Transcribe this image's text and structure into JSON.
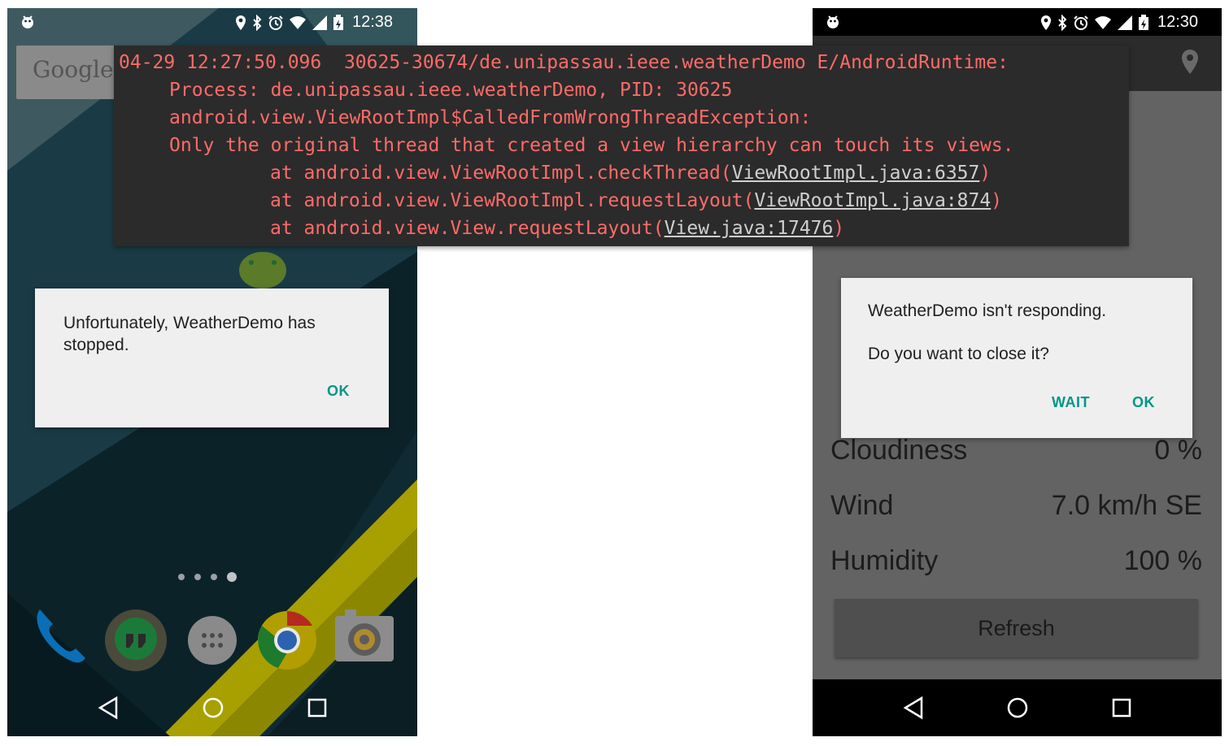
{
  "left_phone": {
    "statusbar": {
      "time": "12:38"
    },
    "search": {
      "logo_text": "Google"
    },
    "home_dots": 4,
    "dock_apps": [
      "phone",
      "hangouts",
      "app-drawer",
      "chrome",
      "camera"
    ],
    "crash_dialog": {
      "message": "Unfortunately, WeatherDemo has stopped.",
      "ok_label": "OK"
    }
  },
  "right_phone": {
    "statusbar": {
      "time": "12:30"
    },
    "anr_dialog": {
      "title": "WeatherDemo isn't responding.",
      "message": "Do you want to close it?",
      "wait_label": "WAIT",
      "ok_label": "OK"
    },
    "weather": [
      {
        "label": "Cloudiness",
        "value": "0 %"
      },
      {
        "label": "Wind",
        "value": "7.0 km/h SE"
      },
      {
        "label": "Humidity",
        "value": "100 %"
      }
    ],
    "refresh_label": "Refresh"
  },
  "logcat": {
    "header": "04-29 12:27:50.096  30625-30674/de.unipassau.ieee.weatherDemo E/AndroidRuntime:",
    "process": "Process: de.unipassau.ieee.weatherDemo, PID: 30625",
    "exception": "android.view.ViewRootImpl$CalledFromWrongThreadException:",
    "message": "Only the original thread that created a view hierarchy can touch its views.",
    "stack": [
      {
        "prefix": "at android.view.ViewRootImpl.checkThread(",
        "link": "ViewRootImpl.java:6357",
        "suffix": ")"
      },
      {
        "prefix": "at android.view.ViewRootImpl.requestLayout(",
        "link": "ViewRootImpl.java:874",
        "suffix": ")"
      },
      {
        "prefix": "at android.view.View.requestLayout(",
        "link": "View.java:17476",
        "suffix": ")"
      }
    ]
  },
  "colors": {
    "accent": "#009688",
    "log_error": "#ff6b68",
    "log_bg": "#2b2b2b"
  }
}
